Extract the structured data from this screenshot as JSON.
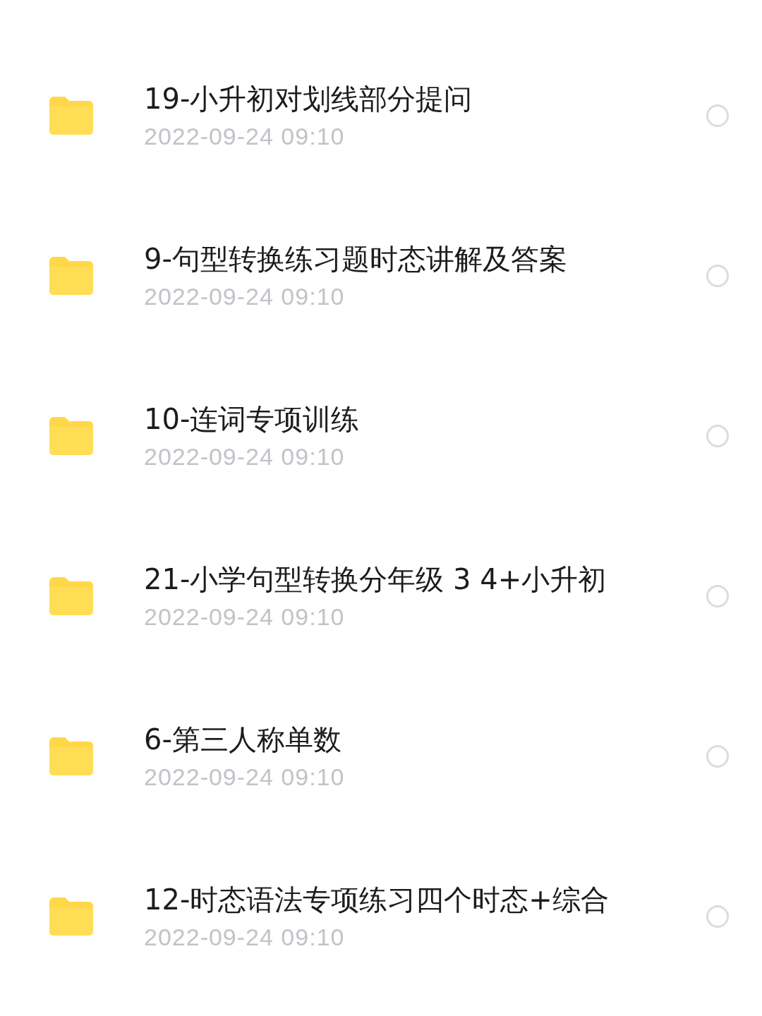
{
  "files": [
    {
      "name": "19-小升初对划线部分提问",
      "date": "2022-09-24 09:10",
      "selected": false
    },
    {
      "name": "9-句型转换练习题时态讲解及答案",
      "date": "2022-09-24 09:10",
      "selected": false
    },
    {
      "name": "10-连词专项训练",
      "date": "2022-09-24 09:10",
      "selected": false
    },
    {
      "name": "21-小学句型转换分年级 3 4+小升初",
      "date": "2022-09-24 09:10",
      "selected": false
    },
    {
      "name": "6-第三人称单数",
      "date": "2022-09-24 09:10",
      "selected": false
    },
    {
      "name": "12-时态语法专项练习四个时态+综合",
      "date": "2022-09-24 09:10",
      "selected": false
    }
  ]
}
